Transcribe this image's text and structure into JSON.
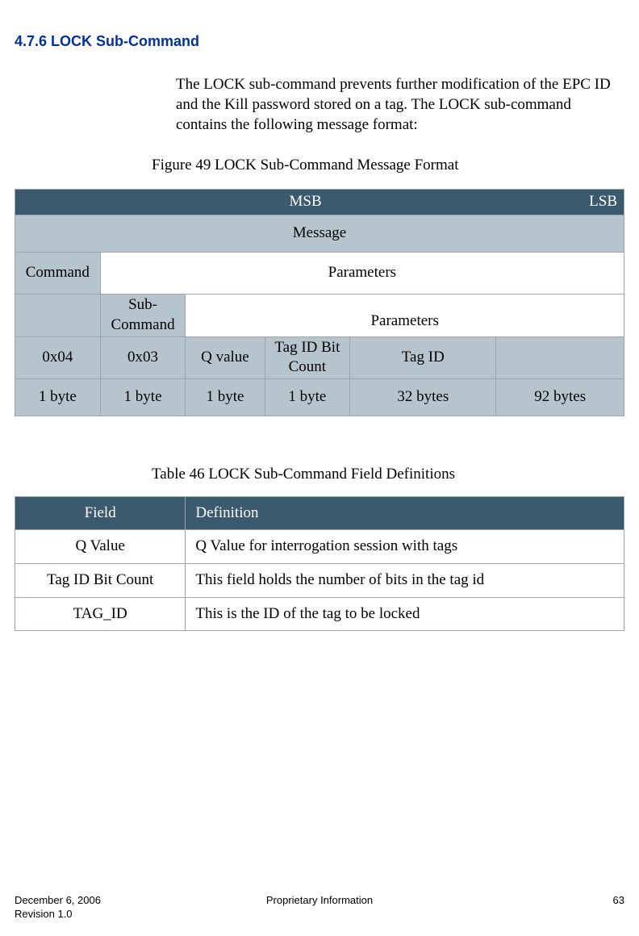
{
  "heading": "4.7.6  LOCK Sub-Command",
  "paragraph": "The LOCK sub-command prevents further modification of the EPC ID and the Kill password stored on a tag.  The LOCK sub-command contains the following message format:",
  "figure_caption": "Figure 49 LOCK Sub-Command Message Format",
  "msb": "MSB",
  "lsb": "LSB",
  "row_message": "Message",
  "row_command": "Command",
  "row_parameters": "Parameters",
  "row_subcommand": "Sub-Command",
  "row_parameters2": "Parameters",
  "fields": {
    "cmd": "0x04",
    "subcmd": "0x03",
    "qvalue": "Q value",
    "bitcount": "Tag ID Bit Count",
    "tagid": "Tag ID",
    "pad": ""
  },
  "sizes": {
    "cmd": "1 byte",
    "subcmd": "1 byte",
    "qvalue": "1 byte",
    "bitcount": "1 byte",
    "tagid": "32 bytes",
    "pad": "92 bytes"
  },
  "table_caption": "Table 46 LOCK Sub-Command Field Definitions",
  "def_header_field": "Field",
  "def_header_def": "Definition",
  "defs": [
    {
      "field": "Q Value",
      "def": "Q Value for interrogation session with tags"
    },
    {
      "field": "Tag ID Bit Count",
      "def": "This field holds the number of bits in the tag id"
    },
    {
      "field": "TAG_ID",
      "def": "This is the ID of the tag to be locked"
    }
  ],
  "footer": {
    "date": "December 6, 2006",
    "revision": "Revision 1.0",
    "center": "Proprietary Information",
    "page": "63"
  }
}
